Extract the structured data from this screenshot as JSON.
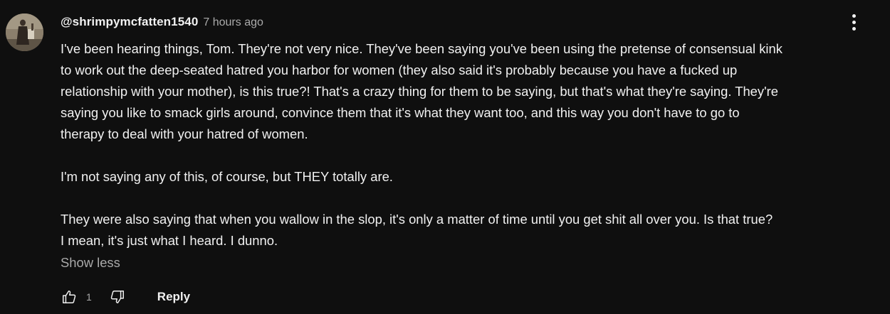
{
  "comment": {
    "author": "@shrimpymcfatten1540",
    "timestamp": "7 hours ago",
    "avatar_icon": "user-avatar",
    "menu_icon": "more-vert-icon",
    "paragraphs": [
      [
        "I've been hearing things, Tom. They're not very nice. They've been saying you've been using the pretense of consensual kink",
        "to work out the deep-seated hatred you harbor for women (they also said it's probably because you have a fucked up",
        "relationship with your mother), is this true?! That's a crazy thing for them to be saying, but that's what they're saying. They're",
        "saying you like to smack girls around, convince them that it's what they want too, and this way you don't have to go to",
        "therapy to deal with your hatred of women."
      ],
      [
        "I'm not saying any of this, of course, but THEY totally are."
      ],
      [
        "They were also saying that when you wallow in the slop, it's only a matter of time until you get shit all over you. Is that true?",
        "I mean, it's just what I heard.  I dunno."
      ]
    ],
    "show_less_label": "Show less",
    "like_count": "1",
    "like_icon": "thumbs-up-icon",
    "dislike_icon": "thumbs-down-icon",
    "reply_label": "Reply"
  },
  "colors": {
    "background": "#0f0f0f",
    "primary_text": "#f1f1f1",
    "secondary_text": "#aaaaaa"
  }
}
